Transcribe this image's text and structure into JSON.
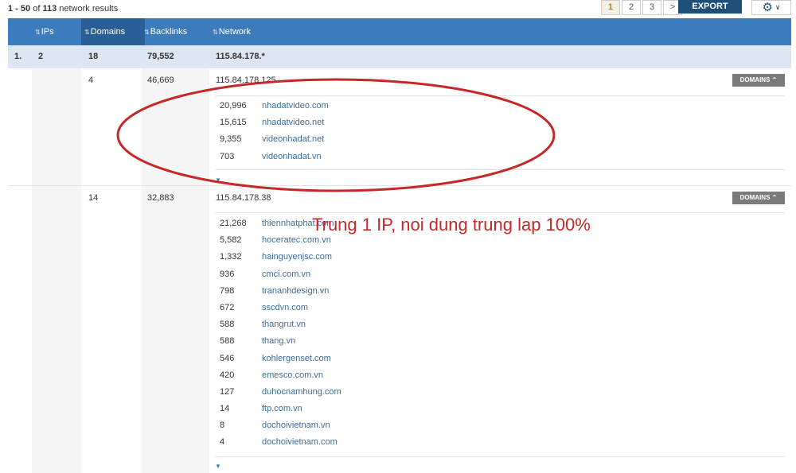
{
  "results": {
    "range": "1 - 50",
    "of_word": "of",
    "total": "113",
    "suffix": "network results"
  },
  "pager": {
    "pages": [
      "1",
      "2",
      "3",
      ">"
    ],
    "active": "1"
  },
  "export_label": "EXPORT",
  "icons": {
    "settings": "gear-icon",
    "sort": "sort-icon",
    "expand": "chevron-down-icon"
  },
  "columns": {
    "ips": "IPs",
    "domains": "Domains",
    "backlinks": "Backlinks",
    "network": "Network"
  },
  "network_row": {
    "rank": "1.",
    "ips": "2",
    "domains": "18",
    "backlinks": "79,552",
    "network": "115.84.178.*"
  },
  "ip_groups": [
    {
      "domains": "4",
      "backlinks": "46,669",
      "ip": "115.84.178.125",
      "button": "DOMAINS",
      "sites": [
        {
          "backlinks": "20,996",
          "name": "nhadatvideo.com"
        },
        {
          "backlinks": "15,615",
          "name": "nhadatvideo.net"
        },
        {
          "backlinks": "9,355",
          "name": "videonhadat.net"
        },
        {
          "backlinks": "703",
          "name": "videonhadat.vn"
        }
      ]
    },
    {
      "domains": "14",
      "backlinks": "32,883",
      "ip": "115.84.178.38",
      "button": "DOMAINS",
      "sites": [
        {
          "backlinks": "21,268",
          "name": "thiennhatphat.com"
        },
        {
          "backlinks": "5,582",
          "name": "hoceratec.com.vn"
        },
        {
          "backlinks": "1,332",
          "name": "hainguyenjsc.com"
        },
        {
          "backlinks": "936",
          "name": "cmci.com.vn"
        },
        {
          "backlinks": "798",
          "name": "trananhdesign.vn"
        },
        {
          "backlinks": "672",
          "name": "sscdvn.com"
        },
        {
          "backlinks": "588",
          "name": "thangrut.vn"
        },
        {
          "backlinks": "588",
          "name": "thang.vn"
        },
        {
          "backlinks": "546",
          "name": "kohlergenset.com"
        },
        {
          "backlinks": "420",
          "name": "emesco.com.vn"
        },
        {
          "backlinks": "127",
          "name": "duhocnamhung.com"
        },
        {
          "backlinks": "14",
          "name": "ftp.com.vn"
        },
        {
          "backlinks": "8",
          "name": "dochoivietnam.vn"
        },
        {
          "backlinks": "4",
          "name": "dochoivietnam.com"
        }
      ]
    }
  ],
  "annotation": {
    "text": "Trung 1 IP, noi dung trung lap 100%",
    "color": "#c62828"
  },
  "colors": {
    "header": "#3d7cbc",
    "header_active": "#295e96",
    "export": "#1f4e79",
    "link": "#3e6c96",
    "network_row": "#dce7f3"
  }
}
